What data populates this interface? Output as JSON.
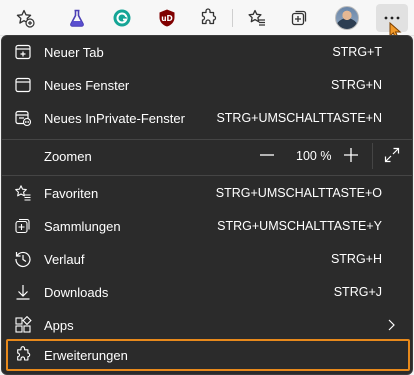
{
  "toolbar": {
    "icons": [
      "favorite-add-icon",
      "flask-icon",
      "grammarly-icon",
      "ublock-origin-icon",
      "extensions-icon",
      "favorites-icon",
      "collections-icon",
      "avatar",
      "more-icon"
    ],
    "ublock_label": "uD"
  },
  "menu": {
    "items": [
      {
        "label": "Neuer Tab",
        "shortcut": "STRG+T"
      },
      {
        "label": "Neues Fenster",
        "shortcut": "STRG+N"
      },
      {
        "label": "Neues InPrivate-Fenster",
        "shortcut": "STRG+UMSCHALTTASTE+N"
      }
    ],
    "zoom": {
      "label": "Zoomen",
      "value": "100 %"
    },
    "items2": [
      {
        "label": "Favoriten",
        "shortcut": "STRG+UMSCHALTTASTE+O"
      },
      {
        "label": "Sammlungen",
        "shortcut": "STRG+UMSCHALTTASTE+Y"
      },
      {
        "label": "Verlauf",
        "shortcut": "STRG+H"
      },
      {
        "label": "Downloads",
        "shortcut": "STRG+J"
      },
      {
        "label": "Apps",
        "shortcut": ""
      },
      {
        "label": "Erweiterungen",
        "shortcut": ""
      }
    ]
  },
  "colors": {
    "menu_bg": "#2b2b2b",
    "highlight": "#e8891b",
    "text": "#ffffff"
  }
}
